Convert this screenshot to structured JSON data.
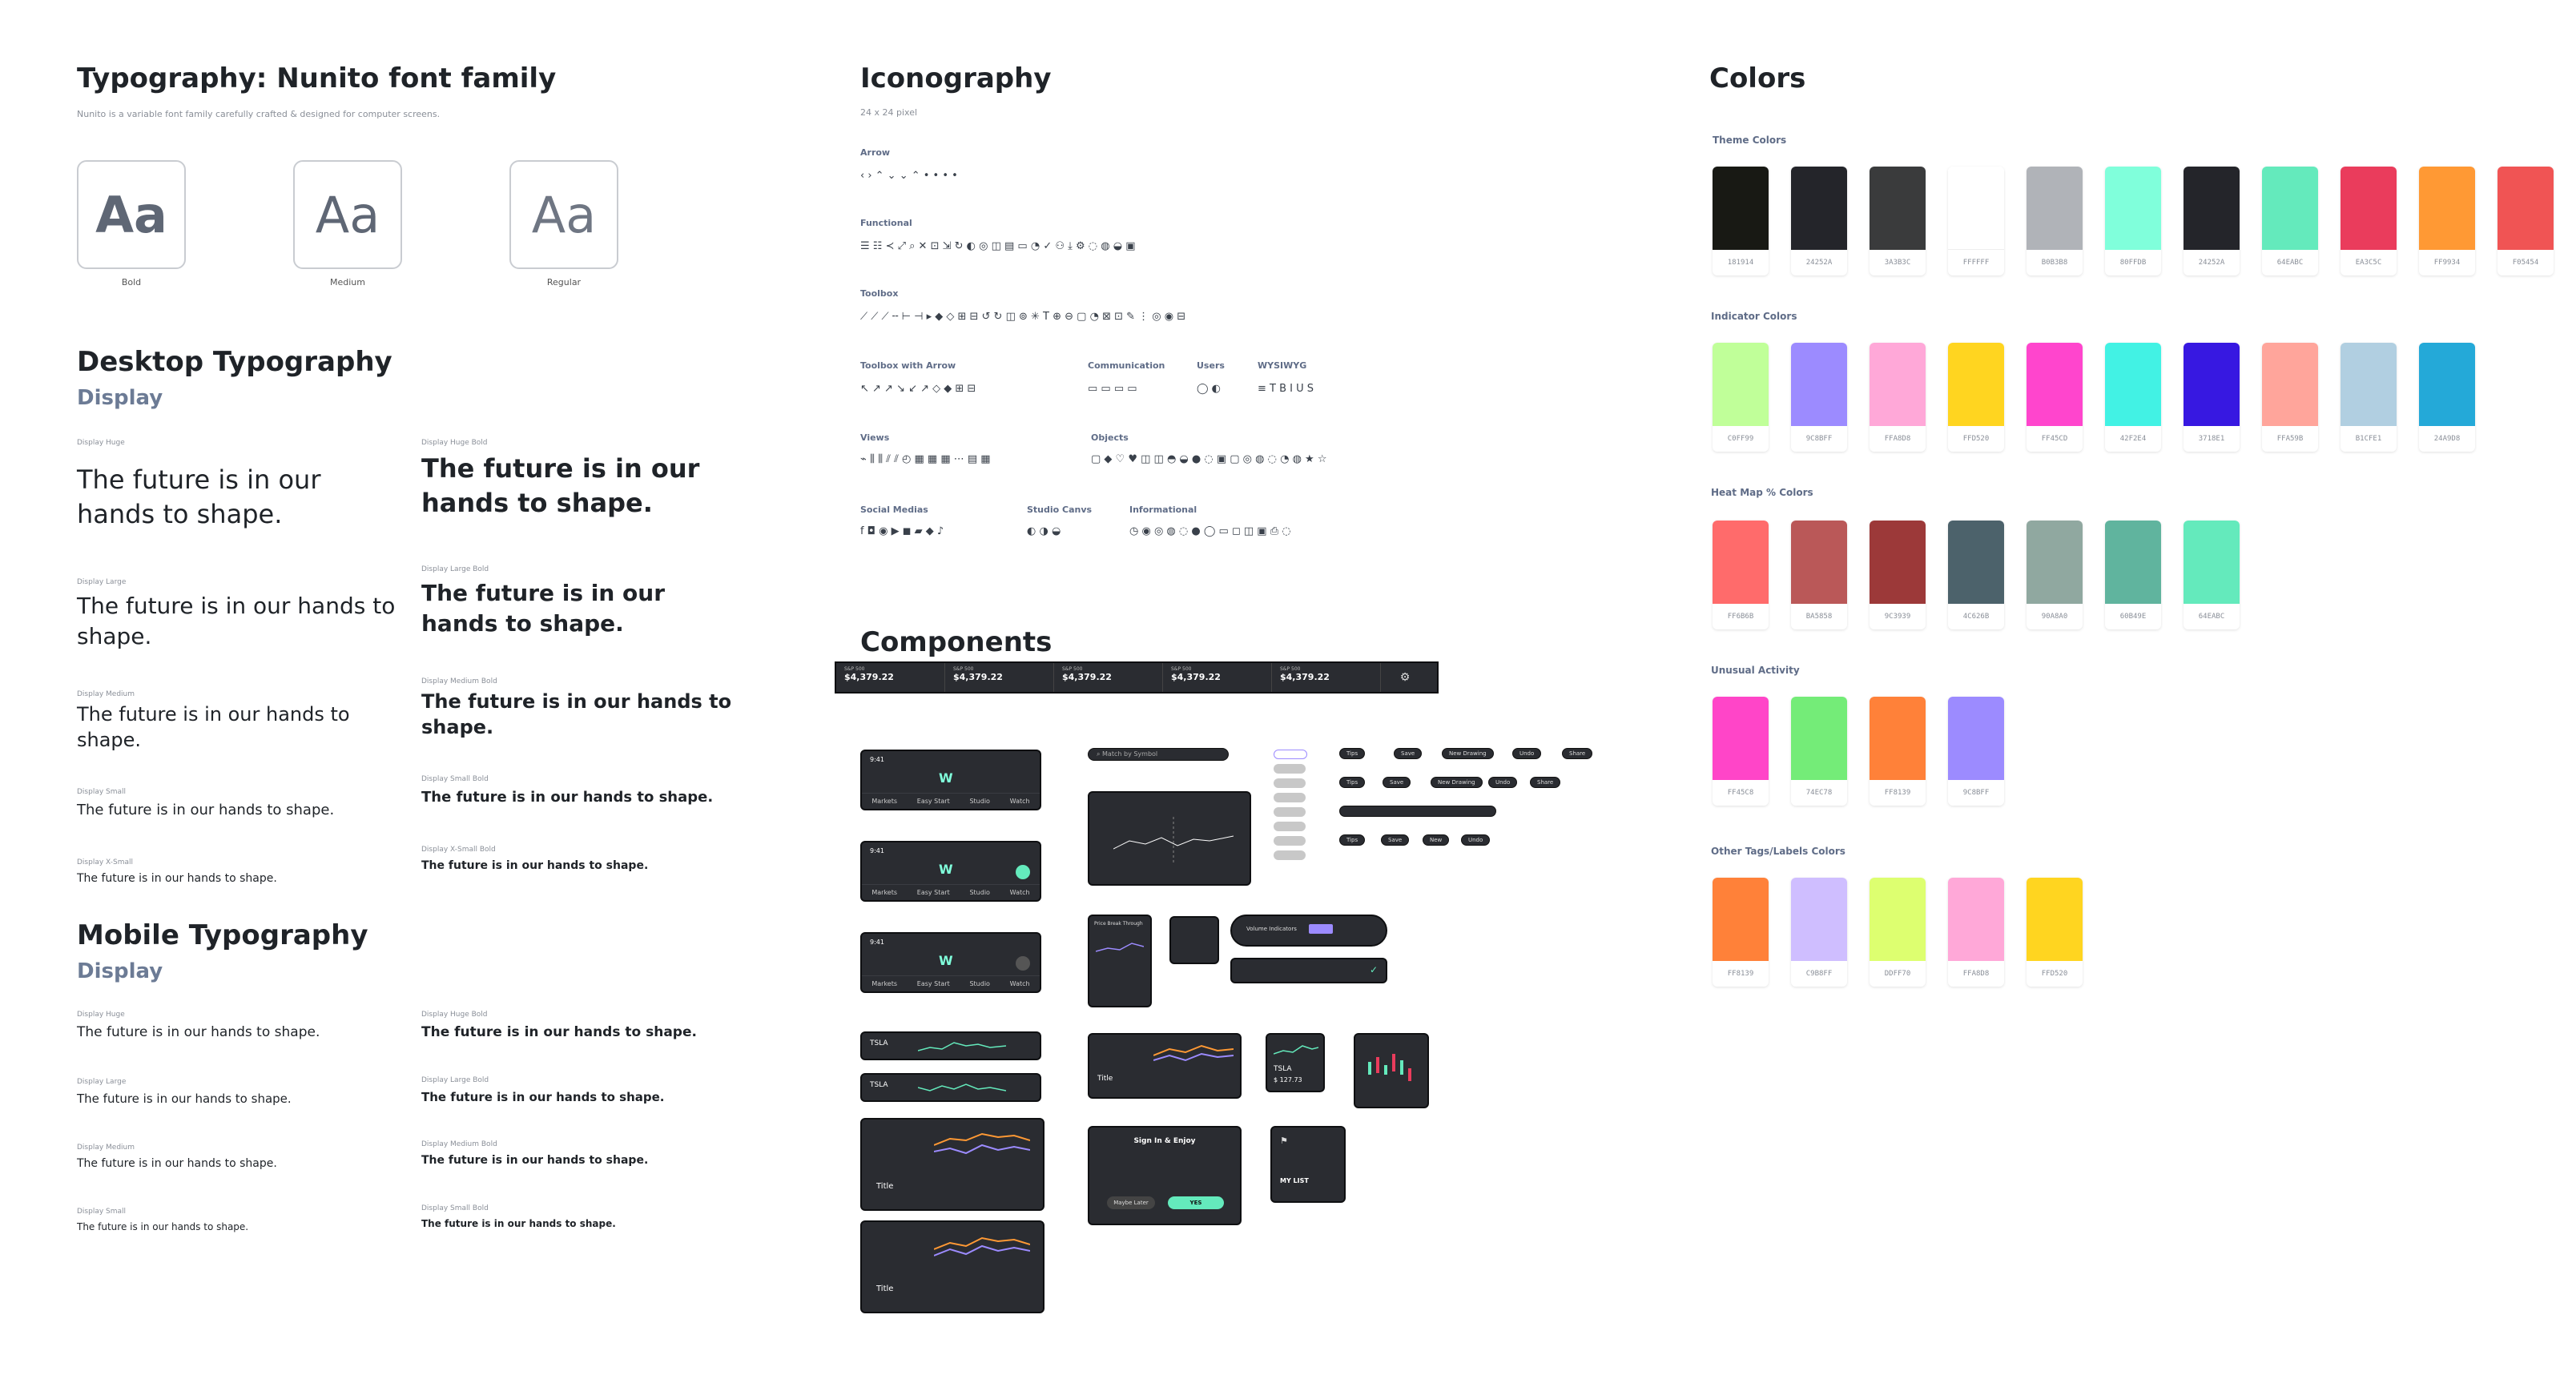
{
  "typography": {
    "title": "Typography: Nunito font family",
    "subtitle": "Nunito is a variable font family carefully crafted & designed for computer screens.",
    "weights": [
      {
        "sample": "Aa",
        "label": "Bold"
      },
      {
        "sample": "Aa",
        "label": "Medium"
      },
      {
        "sample": "Aa",
        "label": "Regular"
      }
    ]
  },
  "desktop": {
    "title": "Desktop Typography",
    "category": "Display",
    "sample_text": "The future is in our hands to shape.",
    "regular_labels": [
      "Display Huge",
      "Display Large",
      "Display Medium",
      "Display Small",
      "Display X-Small"
    ],
    "bold_labels": [
      "Display Huge Bold",
      "Display Large Bold",
      "Display Medium Bold",
      "Display Small Bold",
      "Display X-Small Bold"
    ]
  },
  "mobile": {
    "title": "Mobile Typography",
    "category": "Display",
    "sample_text": "The future is in our hands to shape.",
    "regular_labels": [
      "Display Huge",
      "Display Large",
      "Display Medium",
      "Display Small"
    ],
    "bold_labels": [
      "Display Huge Bold",
      "Display Large Bold",
      "Display Medium Bold",
      "Display Small Bold"
    ]
  },
  "iconography": {
    "title": "Iconography",
    "subtitle": "24 x 24 pixel",
    "groups": [
      "Arrow",
      "Functional",
      "Toolbox",
      "Toolbox with Arrow",
      "Communication",
      "Users",
      "WYSIWYG",
      "Views",
      "Objects",
      "Social Medias",
      "Studio Canvs",
      "Informational"
    ],
    "icons": {
      "arrow": "‹ › ⌃ ⌄ ⌄ ⌃ • • • •",
      "functional": "☰ ☷ ≺ ⤢ ⌕ ✕ ⊡ ⇲ ↻ ◐ ◎ ◫ ▤ ▭ ◔ ✓ ⚇ ⤓ ⚙ ◌ ◍ ◒ ▣",
      "toolbox": "⟋ ⟋ ⟋ ╌ ⊢ ⊣ ▸ ◆ ◇ ⊞ ⊟ ↺ ↻ ◫ ⊚ ✳ T ⊕ ⊖ ▢ ◔ ⊠ ⊡ ✎ ⋮ ◎ ◉ ⊟",
      "toolbox_arrow": "↖ ↗ ↗ ↘ ↙ ↗ ◇ ◆ ⊞ ⊟",
      "communication": "▭ ▭ ▭ ▭",
      "users": "◯ ◐",
      "wysiwyg": "≡ T B I U S",
      "views": "⌁ ⫼ ⫼ ⫽ ⫽ ◴ ▦ ▦ ▦ ⋯ ▤ ▦",
      "objects": "▢ ◆ ♡ ♥ ◫ ◫ ◓ ◒ ● ◌ ▣ ▢ ◎ ◍ ◌ ◔ ◍ ★ ☆",
      "social": "f ◘ ◉ ▶ ◼ ▰ ◆ ♪",
      "studio": "◐ ◑ ◒",
      "informational": "◷ ◉ ◎ ◍ ◌ ● ◯ ▭ ◻ ◫ ▣ ⎙ ◌"
    }
  },
  "components": {
    "title": "Components",
    "ticker": {
      "items": [
        {
          "name": "S&P 500",
          "value": "$4,379.22"
        },
        {
          "name": "S&P 500",
          "value": "$4,379.22"
        },
        {
          "name": "S&P 500",
          "value": "$4,379.22"
        },
        {
          "name": "S&P 500",
          "value": "$4,379.22"
        },
        {
          "name": "S&P 500",
          "value": "$4,379.22"
        }
      ]
    },
    "mobile_nav": [
      "Markets",
      "Easy Start",
      "Studio",
      "Watch"
    ],
    "time": "9:41",
    "search_placeholder": "Match by Symbol",
    "tsla": "TSLA",
    "tsla_price": "$ 127.73",
    "card_title": "Title",
    "sign_in_title": "Sign In & Enjoy",
    "maybe_later": "Maybe Later",
    "yes": "YES",
    "my_list": "MY LIST",
    "volume_label": "Volume Indicators",
    "buttons_row1": [
      "Tips",
      "Save",
      "New Drawing",
      "Undo",
      "Share"
    ],
    "buttons_row2": [
      "Tips",
      "Save",
      "New Drawing",
      "Undo",
      "Share"
    ],
    "buttons_row4": [
      "Tips",
      "Save",
      "New",
      "Undo"
    ],
    "price_break": "Price Break Through"
  },
  "colors": {
    "title": "Colors",
    "theme": {
      "label": "Theme Colors",
      "swatches": [
        {
          "hex": "#181914",
          "code": "181914"
        },
        {
          "hex": "#24252A",
          "code": "24252A"
        },
        {
          "hex": "#3A3B3C",
          "code": "3A3B3C"
        },
        {
          "hex": "#FFFFFF",
          "code": "FFFFFF"
        },
        {
          "hex": "#B0B3B8",
          "code": "B0B3B8"
        },
        {
          "hex": "#80FFDB",
          "code": "80FFDB"
        },
        {
          "hex": "#24252A",
          "code": "24252A"
        },
        {
          "hex": "#64EABC",
          "code": "64EABC"
        },
        {
          "hex": "#EA3C5C",
          "code": "EA3C5C"
        },
        {
          "hex": "#FF9934",
          "code": "FF9934"
        },
        {
          "hex": "#F05454",
          "code": "F05454"
        }
      ]
    },
    "indicator": {
      "label": "Indicator Colors",
      "swatches": [
        {
          "hex": "#C0FF99",
          "code": "C0FF99"
        },
        {
          "hex": "#9C8BFF",
          "code": "9C8BFF"
        },
        {
          "hex": "#FFA8D8",
          "code": "FFA8D8"
        },
        {
          "hex": "#FFD520",
          "code": "FFD520"
        },
        {
          "hex": "#FF45CD",
          "code": "FF45CD"
        },
        {
          "hex": "#42F2E4",
          "code": "42F2E4"
        },
        {
          "hex": "#3718E1",
          "code": "3718E1"
        },
        {
          "hex": "#FFA59B",
          "code": "FFA59B"
        },
        {
          "hex": "#B1CFE1",
          "code": "B1CFE1"
        },
        {
          "hex": "#24A9D8",
          "code": "24A9D8"
        }
      ]
    },
    "heatmap": {
      "label": "Heat Map % Colors",
      "swatches": [
        {
          "hex": "#FF6B6B",
          "code": "FF6B6B"
        },
        {
          "hex": "#BA5858",
          "code": "BA5858"
        },
        {
          "hex": "#9C3939",
          "code": "9C3939"
        },
        {
          "hex": "#4C626B",
          "code": "4C626B"
        },
        {
          "hex": "#90A8A0",
          "code": "90A8A0"
        },
        {
          "hex": "#60B49E",
          "code": "60B49E"
        },
        {
          "hex": "#64EABC",
          "code": "64EABC"
        }
      ]
    },
    "unusual": {
      "label": "Unusual Activity",
      "swatches": [
        {
          "hex": "#FF45C8",
          "code": "FF45C8"
        },
        {
          "hex": "#74EC78",
          "code": "74EC78"
        },
        {
          "hex": "#FF8139",
          "code": "FF8139"
        },
        {
          "hex": "#9C8BFF",
          "code": "9C8BFF"
        }
      ]
    },
    "other": {
      "label": "Other Tags/Labels Colors",
      "swatches": [
        {
          "hex": "#FF8139",
          "code": "FF8139"
        },
        {
          "hex": "#CFBEFF",
          "code": "C9B8FF"
        },
        {
          "hex": "#DDFF70",
          "code": "DDFF70"
        },
        {
          "hex": "#FFA8D8",
          "code": "FFA8D8"
        },
        {
          "hex": "#FFD520",
          "code": "FFD520"
        }
      ]
    }
  }
}
